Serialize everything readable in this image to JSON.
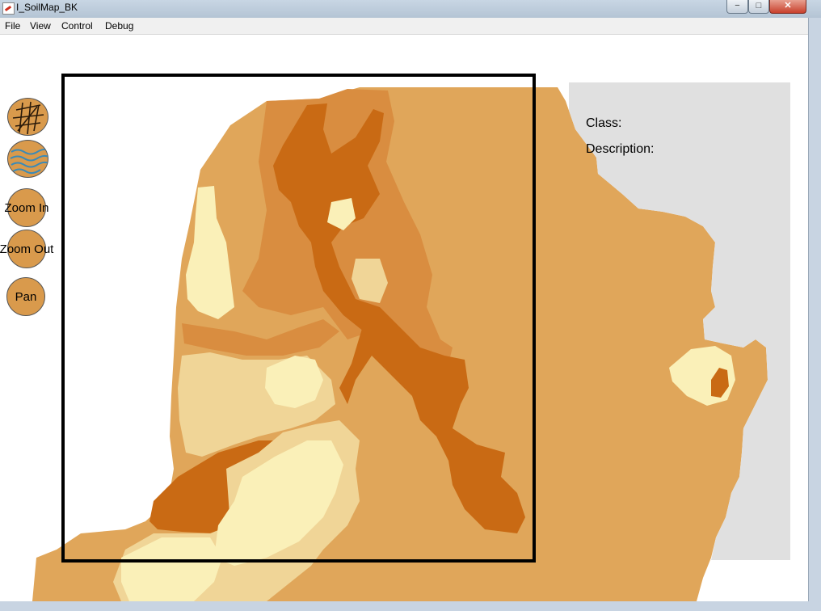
{
  "window": {
    "title": "I_SoilMap_BK",
    "minimize": "−",
    "maximize": "□",
    "close": "✕"
  },
  "menu": [
    "File",
    "View",
    "Control",
    "Debug"
  ],
  "tools": {
    "roads_icon": "roads-icon",
    "water_icon": "water-icon",
    "zoom_in": "Zoom In",
    "zoom_out": "Zoom Out",
    "pan": "Pan"
  },
  "info": {
    "class_label": "Class:",
    "description_label": "Description:"
  },
  "colors": {
    "soil_base": "#e0a65a",
    "soil_mid": "#d98d40",
    "soil_dark": "#c96a14",
    "soil_light": "#f0d597",
    "soil_pale": "#faf0b8",
    "water": "#e0e0e0",
    "button": "#d99a4c"
  }
}
